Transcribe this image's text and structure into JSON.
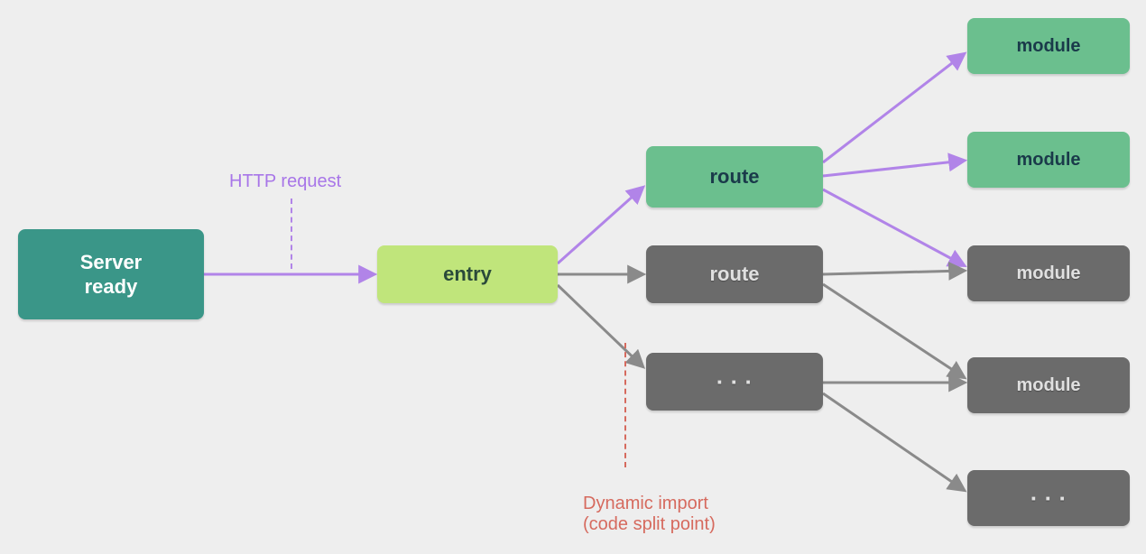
{
  "nodes": {
    "server": "Server\nready",
    "entry": "entry",
    "route_green": "route",
    "route_gray": "route",
    "dots_gray": "· · ·",
    "module_green_1": "module",
    "module_green_2": "module",
    "module_gray_1": "module",
    "module_gray_2": "module",
    "module_dots": "· · ·"
  },
  "labels": {
    "http_request": "HTTP request",
    "dynamic_import": "Dynamic import\n(code split point)"
  },
  "colors": {
    "purple": "#b184e8",
    "gray": "#8a8a8a",
    "red": "#d66a5e"
  }
}
